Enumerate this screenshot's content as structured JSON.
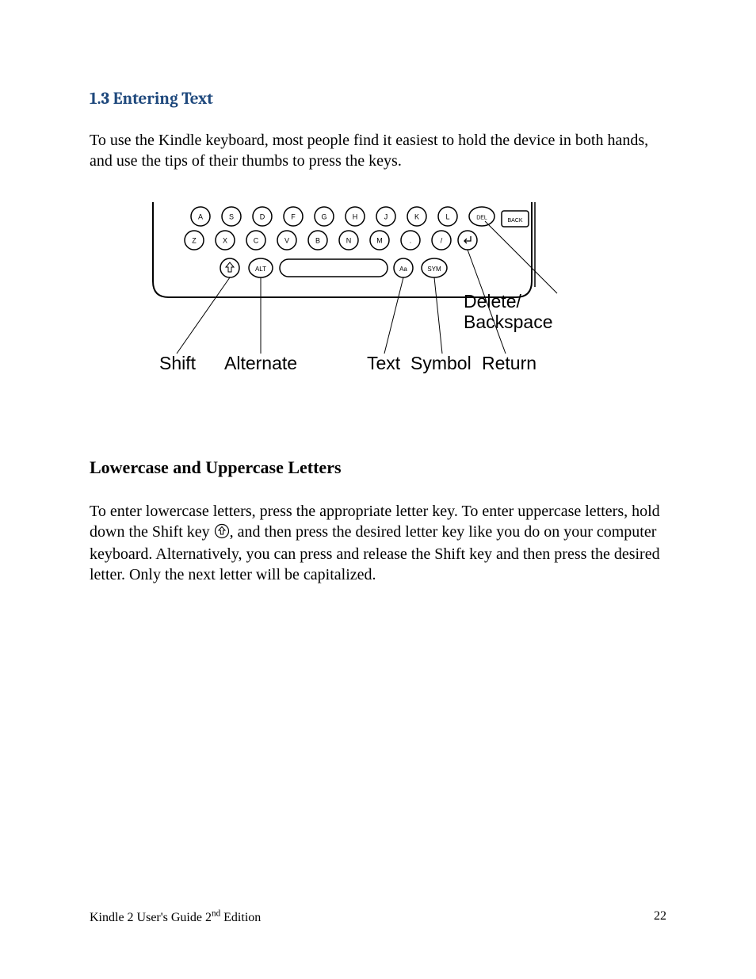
{
  "section": {
    "heading": "1.3 Entering Text",
    "para1": "To use the Kindle keyboard, most people find it easiest to hold the device in both hands, and use the tips of their thumbs to press the keys."
  },
  "diagram": {
    "row1": [
      "A",
      "S",
      "D",
      "F",
      "G",
      "H",
      "J",
      "K",
      "L",
      "DEL"
    ],
    "row2": [
      "Z",
      "X",
      "C",
      "V",
      "B",
      "N",
      "M",
      ".",
      "/"
    ],
    "back_label": "BACK",
    "alt_label": "ALT",
    "sym_label": "SYM",
    "text_label": "Aa",
    "labels": {
      "shift": "Shift",
      "alternate": "Alternate",
      "text": "Text",
      "symbol": "Symbol",
      "return": "Return",
      "delete_1": "Delete/",
      "delete_2": "Backspace"
    }
  },
  "sub": {
    "heading": "Lowercase and Uppercase Letters",
    "para_a": "To enter lowercase letters, press the appropriate letter key. To enter uppercase letters, hold down the Shift key ",
    "para_b": ", and then press the desired letter key like you do on your computer keyboard. Alternatively, you can press and release the Shift key and then press the desired letter. Only the next letter will be capitalized."
  },
  "footer": {
    "title_a": "Kindle 2 User's Guide 2",
    "title_b": " Edition",
    "sup": "nd",
    "page": "22"
  }
}
